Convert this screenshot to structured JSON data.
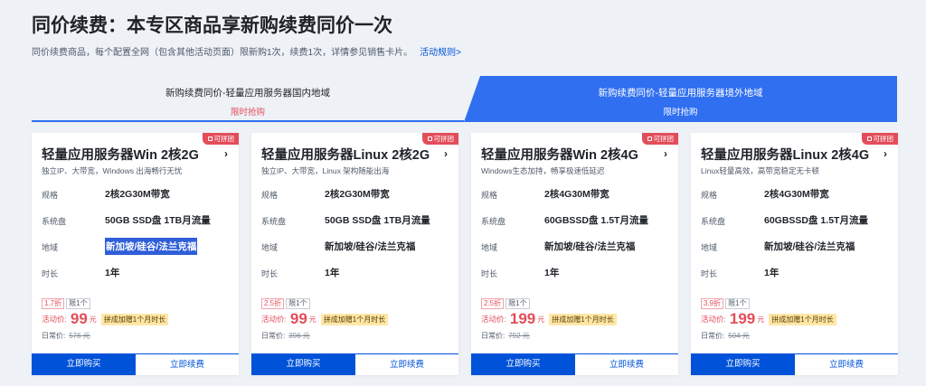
{
  "header": {
    "title": "同价续费：本专区商品享新购续费同价一次",
    "subtitle": "同价续费商品，每个配置全网（包含其他活动页面）限新购1次，续费1次，详情参见销售卡片。",
    "rules_link": "活动规则>"
  },
  "tabs": [
    {
      "label": "新购续费同价-轻量应用服务器国内地域",
      "sub": "限时抢购",
      "active": false
    },
    {
      "label": "新购续费同价-轻量应用服务器境外地域",
      "sub": "限时抢购",
      "active": true
    }
  ],
  "colors": {
    "accent": "#0052d9",
    "price": "#e34d59",
    "tab_active": "#2f6ff0"
  },
  "spec_labels": {
    "spec": "规格",
    "disk": "系统盘",
    "region": "地域",
    "duration": "时长"
  },
  "cards": [
    {
      "badge": "可拼团",
      "title": "轻量应用服务器Win 2核2G",
      "desc": "独立IP、大带宽，Windows 出海畅行无忧",
      "spec": "2核2G30M带宽",
      "disk": "50GB SSD盘 1TB月流量",
      "region": "新加坡/硅谷/法兰克福",
      "duration": "1年",
      "discount": "1.7折",
      "limit": "限1个",
      "price_label": "活动价:",
      "price": "99",
      "unit": "元",
      "promo": "拼成加赠1个月时长",
      "orig_label": "日常价:",
      "orig_price": "576 元",
      "buy": "立即购买",
      "renew": "立即续费"
    },
    {
      "badge": "可拼团",
      "title": "轻量应用服务器Linux 2核2G",
      "desc": "独立IP、大带宽，Linux 架构随能出海",
      "spec": "2核2G30M带宽",
      "disk": "50GB SSD盘 1TB月流量",
      "region": "新加坡/硅谷/法兰克福",
      "duration": "1年",
      "discount": "2.5折",
      "limit": "限1个",
      "price_label": "活动价:",
      "price": "99",
      "unit": "元",
      "promo": "拼成加赠1个月时长",
      "orig_label": "日常价:",
      "orig_price": "396 元",
      "buy": "立即购买",
      "renew": "立即续费"
    },
    {
      "badge": "可拼团",
      "title": "轻量应用服务器Win 2核4G",
      "desc": "Windows生态加持，畅享极速低延迟",
      "spec": "2核4G30M带宽",
      "disk": "60GBSSD盘 1.5T月流量",
      "region": "新加坡/硅谷/法兰克福",
      "duration": "1年",
      "discount": "2.5折",
      "limit": "限1个",
      "price_label": "活动价:",
      "price": "199",
      "unit": "元",
      "promo": "拼成加赠1个月时长",
      "orig_label": "日常价:",
      "orig_price": "792 元",
      "buy": "立即购买",
      "renew": "立即续费"
    },
    {
      "badge": "可拼团",
      "title": "轻量应用服务器Linux 2核4G",
      "desc": "Linux轻量高效，高带宽稳定无卡顿",
      "spec": "2核4G30M带宽",
      "disk": "60GBSSD盘 1.5T月流量",
      "region": "新加坡/硅谷/法兰克福",
      "duration": "1年",
      "discount": "3.9折",
      "limit": "限1个",
      "price_label": "活动价:",
      "price": "199",
      "unit": "元",
      "promo": "拼成加赠1个月时长",
      "orig_label": "日常价:",
      "orig_price": "504 元",
      "buy": "立即购买",
      "renew": "立即续费"
    }
  ]
}
